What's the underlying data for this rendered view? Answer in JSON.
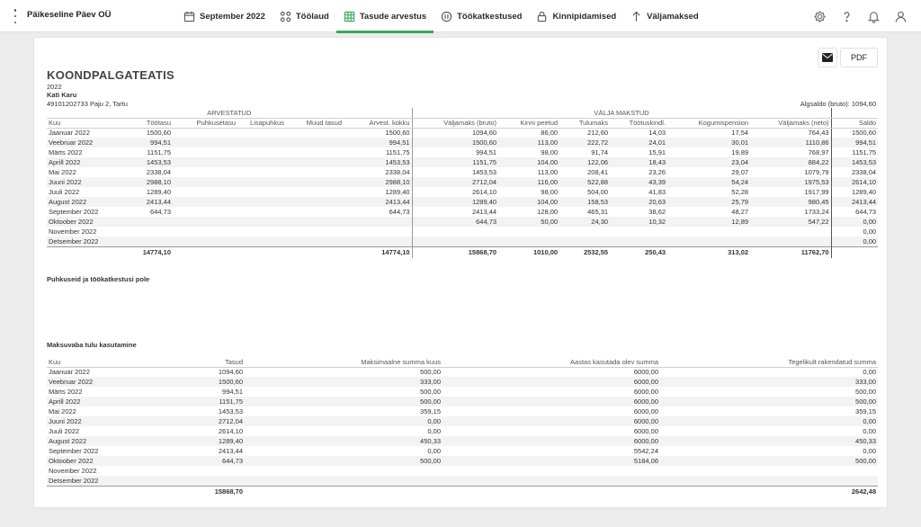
{
  "app": {
    "company": "Päikeseline Päev OÜ",
    "nav": [
      {
        "label": "September 2022",
        "icon": "calendar-icon"
      },
      {
        "label": "Töölaud",
        "icon": "dashboard-icon"
      },
      {
        "label": "Tasude arvestus",
        "icon": "table-icon",
        "active": true
      },
      {
        "label": "Töökatkestused",
        "icon": "pause-icon"
      },
      {
        "label": "Kinnipidamised",
        "icon": "lock-icon"
      },
      {
        "label": "Väljamaksed",
        "icon": "arrow-up-icon"
      }
    ],
    "right_icons": [
      "settings-icon",
      "help-icon",
      "bell-icon",
      "user-icon"
    ],
    "accent": "#3aa85a"
  },
  "report": {
    "pdf_label": "PDF",
    "title": "KOONDPALGATEATIS",
    "year": "2022",
    "employee_name": "Kati Karu",
    "employee_details": "49101202733 Paju 2, Tartu",
    "opening_balance": "Algsaldo (bruto): 1094,60",
    "group_calculated": "ARVESTATUD",
    "group_paid": "VÄLJA MAKSTUD",
    "headers": [
      "Kuu",
      "Töötasu",
      "Puhkusetasu",
      "Lisapuhkus",
      "Muud tasud",
      "Arvest. kokku",
      "Väljamaks (bruto)",
      "Kinni peetud",
      "Tulumaks",
      "Töötuskindl.",
      "Kogumispension",
      "Väljamaks (neto)",
      "Saldo"
    ],
    "rows": [
      [
        "Jaanuar 2022",
        "1500,60",
        "",
        "",
        "",
        "1500,60",
        "1094,60",
        "86,00",
        "212,60",
        "14,03",
        "17,54",
        "764,43",
        "1500,60"
      ],
      [
        "Veebruar 2022",
        "994,51",
        "",
        "",
        "",
        "994,51",
        "1500,60",
        "113,00",
        "222,72",
        "24,01",
        "30,01",
        "1110,86",
        "994,51"
      ],
      [
        "Märts 2022",
        "1151,75",
        "",
        "",
        "",
        "1151,75",
        "994,51",
        "98,00",
        "91,74",
        "15,91",
        "19,89",
        "768,97",
        "1151,75"
      ],
      [
        "Aprill 2022",
        "1453,53",
        "",
        "",
        "",
        "1453,53",
        "1151,75",
        "104,00",
        "122,06",
        "18,43",
        "23,04",
        "884,22",
        "1453,53"
      ],
      [
        "Mai 2022",
        "2338,04",
        "",
        "",
        "",
        "2338,04",
        "1453,53",
        "113,00",
        "208,41",
        "23,26",
        "29,07",
        "1079,79",
        "2338,04"
      ],
      [
        "Juuni 2022",
        "2988,10",
        "",
        "",
        "",
        "2988,10",
        "2712,04",
        "116,00",
        "522,88",
        "43,39",
        "54,24",
        "1975,53",
        "2614,10"
      ],
      [
        "Juuli 2022",
        "1289,40",
        "",
        "",
        "",
        "1289,40",
        "2614,10",
        "98,00",
        "504,00",
        "41,83",
        "52,28",
        "1917,99",
        "1289,40"
      ],
      [
        "August 2022",
        "2413,44",
        "",
        "",
        "",
        "2413,44",
        "1289,40",
        "104,00",
        "158,53",
        "20,63",
        "25,79",
        "980,45",
        "2413,44"
      ],
      [
        "September 2022",
        "644,73",
        "",
        "",
        "",
        "644,73",
        "2413,44",
        "128,00",
        "465,31",
        "38,62",
        "48,27",
        "1733,24",
        "644,73"
      ],
      [
        "Oktoober 2022",
        "",
        "",
        "",
        "",
        "",
        "644,73",
        "50,00",
        "24,30",
        "10,32",
        "12,89",
        "547,22",
        "0,00"
      ],
      [
        "November 2022",
        "",
        "",
        "",
        "",
        "",
        "",
        "",
        "",
        "",
        "",
        "",
        "0,00"
      ],
      [
        "Detsember 2022",
        "",
        "",
        "",
        "",
        "",
        "",
        "",
        "",
        "",
        "",
        "",
        "0,00"
      ]
    ],
    "totals": [
      "",
      "14774,10",
      "",
      "",
      "",
      "14774,10",
      "15868,70",
      "1010,00",
      "2532,55",
      "250,43",
      "313,02",
      "11762,70",
      ""
    ],
    "no_absence_text": "Puhkuseid ja töökatkestusi pole",
    "tax_free_title": "Maksuvaba tulu kasutamine",
    "tax_headers": [
      "Kuu",
      "Tasud",
      "Maksimaalne summa kuus",
      "Aastas kasutada olev summa",
      "Tegelikult rakendatud summa"
    ],
    "tax_rows": [
      [
        "Jaanuar 2022",
        "1094,60",
        "500,00",
        "6000,00",
        "0,00"
      ],
      [
        "Veebruar 2022",
        "1500,60",
        "333,00",
        "6000,00",
        "333,00"
      ],
      [
        "Märts 2022",
        "994,51",
        "500,00",
        "6000,00",
        "500,00"
      ],
      [
        "Aprill 2022",
        "1151,75",
        "500,00",
        "6000,00",
        "500,00"
      ],
      [
        "Mai 2022",
        "1453,53",
        "359,15",
        "6000,00",
        "359,15"
      ],
      [
        "Juuni 2022",
        "2712,04",
        "0,00",
        "6000,00",
        "0,00"
      ],
      [
        "Juuli 2022",
        "2614,10",
        "0,00",
        "6000,00",
        "0,00"
      ],
      [
        "August 2022",
        "1289,40",
        "450,33",
        "6000,00",
        "450,33"
      ],
      [
        "September 2022",
        "2413,44",
        "0,00",
        "5542,24",
        "0,00"
      ],
      [
        "Oktoober 2022",
        "644,73",
        "500,00",
        "5184,06",
        "500,00"
      ],
      [
        "November 2022",
        "",
        "",
        "",
        ""
      ],
      [
        "Detsember 2022",
        "",
        "",
        "",
        ""
      ]
    ],
    "tax_totals": [
      "",
      "15868,70",
      "",
      "",
      "2642,48"
    ]
  }
}
